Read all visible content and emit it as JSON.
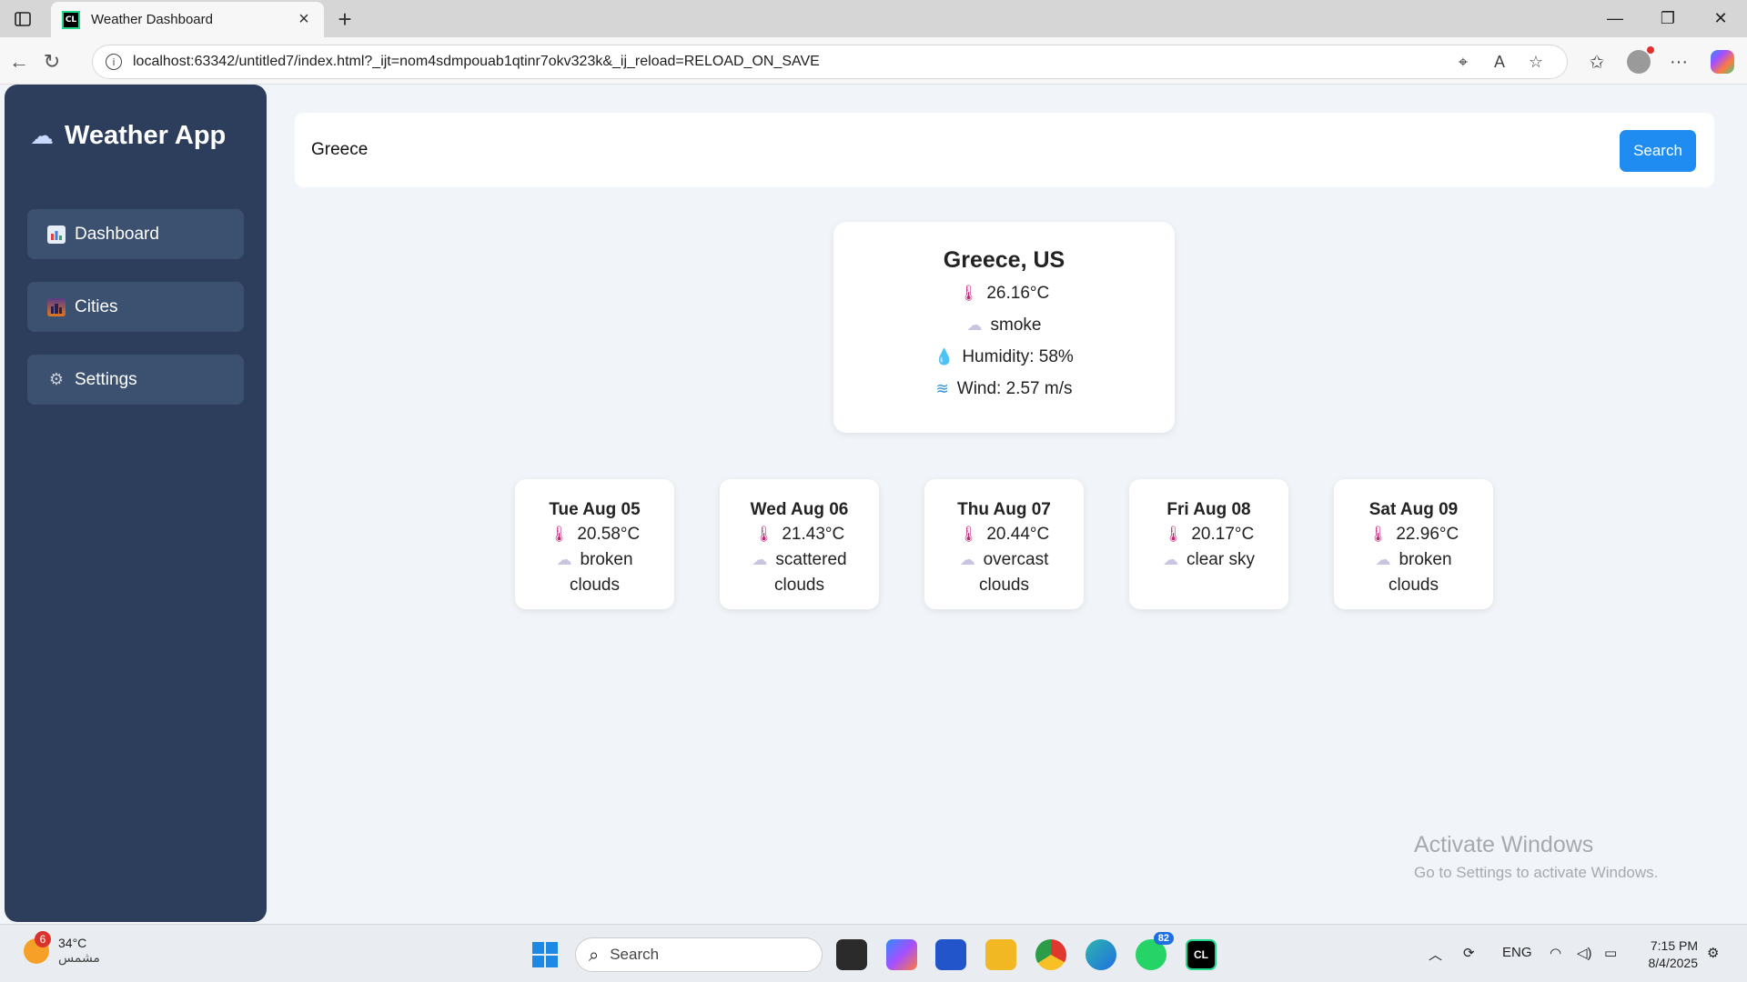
{
  "browser": {
    "tab_title": "Weather Dashboard",
    "favicon_text": "CL",
    "url": "localhost:63342/untitled7/index.html?_ijt=nom4sdmpouab1qtinr7okv323k&_ij_reload=RELOAD_ON_SAVE"
  },
  "app": {
    "brand": "Weather App",
    "nav": [
      {
        "label": "Dashboard",
        "icon": "bar-chart-icon"
      },
      {
        "label": "Cities",
        "icon": "cityscape-icon"
      },
      {
        "label": "Settings",
        "icon": "gear-icon"
      }
    ]
  },
  "search": {
    "value": "Greece",
    "button_label": "Search"
  },
  "current": {
    "city": "Greece, US",
    "temp": "26.16°C",
    "condition": "smoke",
    "humidity": "Humidity: 58%",
    "wind": "Wind: 2.57 m/s"
  },
  "forecast": [
    {
      "date": "Tue Aug 05",
      "temp": "20.58°C",
      "desc1": "broken",
      "desc2": "clouds"
    },
    {
      "date": "Wed Aug 06",
      "temp": "21.43°C",
      "desc1": "scattered",
      "desc2": "clouds"
    },
    {
      "date": "Thu Aug 07",
      "temp": "20.44°C",
      "desc1": "overcast",
      "desc2": "clouds"
    },
    {
      "date": "Fri Aug 08",
      "temp": "20.17°C",
      "desc1": "clear sky",
      "desc2": ""
    },
    {
      "date": "Sat Aug 09",
      "temp": "22.96°C",
      "desc1": "broken",
      "desc2": "clouds"
    }
  ],
  "watermark": {
    "line1": "Activate Windows",
    "line2": "Go to Settings to activate Windows."
  },
  "taskbar": {
    "weather_badge": "6",
    "weather_temp": "34°C",
    "weather_cond": "مشمس",
    "search_placeholder": "Search",
    "whatsapp_badge": "82",
    "lang": "ENG",
    "time": "7:15 PM",
    "date": "8/4/2025"
  },
  "colors": {
    "sidebar": "#2c3e5c",
    "nav_item": "#3c5070",
    "accent": "#1e8cf0",
    "background": "#f1f4f8"
  }
}
